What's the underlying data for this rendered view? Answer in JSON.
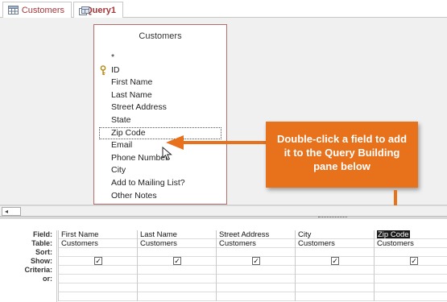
{
  "tabs": [
    {
      "label": "Customers",
      "active": false
    },
    {
      "label": "Query1",
      "active": true
    }
  ],
  "table": {
    "title": "Customers",
    "fields": [
      "*",
      "ID",
      "First Name",
      "Last Name",
      "Street Address",
      "State",
      "Zip Code",
      "Email",
      "Phone Number",
      "City",
      "Add to Mailing List?",
      "Other Notes"
    ],
    "primary_key": "ID",
    "selected_field": "Zip Code"
  },
  "callout": {
    "text": "Double-click a field to add it to the Query Building pane below",
    "color": "#e8711b"
  },
  "grid": {
    "row_labels": [
      "Field:",
      "Table:",
      "Sort:",
      "Show:",
      "Criteria:",
      "or:"
    ],
    "columns": [
      {
        "field": "First Name",
        "table": "Customers",
        "show": true
      },
      {
        "field": "Last Name",
        "table": "Customers",
        "show": true
      },
      {
        "field": "Street Address",
        "table": "Customers",
        "show": true
      },
      {
        "field": "City",
        "table": "Customers",
        "show": true
      },
      {
        "field": "Zip Code",
        "table": "Customers",
        "show": true,
        "highlighted": true
      }
    ]
  },
  "icons": {
    "table_tab": "table-icon",
    "query_tab": "query-icon",
    "primary_key": "key-icon",
    "pointer": "mouse-pointer-icon"
  }
}
